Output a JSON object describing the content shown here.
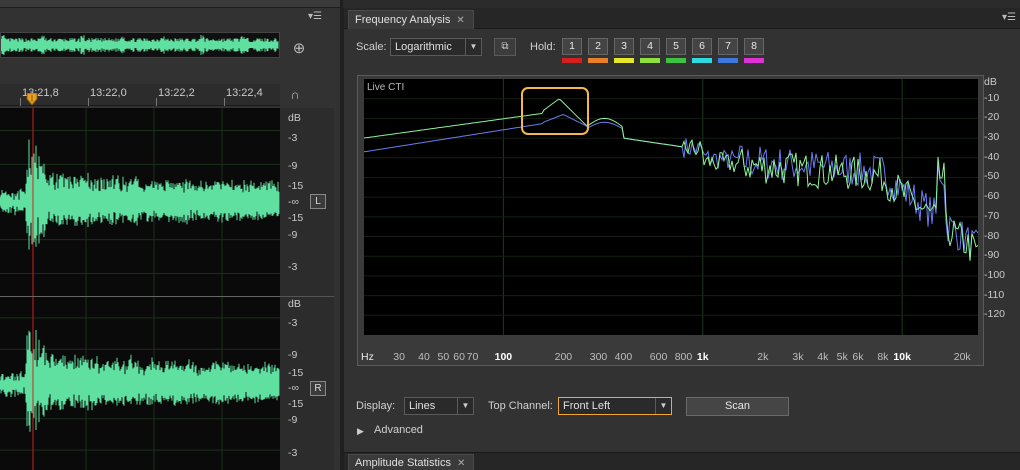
{
  "left_panel": {
    "ruler_labels": [
      "13:21,8",
      "13:22,0",
      "13:22,2",
      "13:22,4"
    ],
    "channel_l": {
      "db_labels": [
        "dB",
        "-3",
        "-9",
        "-15",
        "-∞",
        "-15",
        "-9",
        "-3"
      ],
      "badge": "L"
    },
    "channel_r": {
      "db_labels": [
        "dB",
        "-3",
        "-9",
        "-15",
        "-∞",
        "-15",
        "-9",
        "-3"
      ],
      "badge": "R"
    },
    "icons": {
      "zoom": "zoom-in-icon",
      "snap": "magnet-icon",
      "playhead": "playhead-marker-icon",
      "menu": "panel-menu-icon"
    },
    "waveform_color": "#5fe0a0"
  },
  "frequency_analysis": {
    "tab_label": "Frequency Analysis",
    "scale_label": "Scale:",
    "scale_value": "Logarithmic",
    "hold_label": "Hold:",
    "hold_buttons": [
      {
        "label": "1",
        "color": "#d42020"
      },
      {
        "label": "2",
        "color": "#e8802a"
      },
      {
        "label": "3",
        "color": "#e6e62a"
      },
      {
        "label": "4",
        "color": "#8ee03a"
      },
      {
        "label": "5",
        "color": "#3cc43c"
      },
      {
        "label": "6",
        "color": "#30d8e0"
      },
      {
        "label": "7",
        "color": "#3c7ae0"
      },
      {
        "label": "8",
        "color": "#e030d8"
      }
    ],
    "live_label": "Live CTI",
    "freq_axis": {
      "hz_label": "Hz",
      "labels": [
        "30",
        "40",
        "50",
        "60",
        "70",
        "100",
        "200",
        "300",
        "400",
        "600",
        "800",
        "1k",
        "2k",
        "3k",
        "4k",
        "5k",
        "6k",
        "8k",
        "10k",
        "20k"
      ]
    },
    "db_axis": [
      "dB",
      "-10",
      "-20",
      "-30",
      "-40",
      "-50",
      "-60",
      "-70",
      "-80",
      "-90",
      "-100",
      "-110",
      "-120"
    ],
    "display_label": "Display:",
    "display_value": "Lines",
    "top_channel_label": "Top Channel:",
    "top_channel_value": "Front Left",
    "scan_label": "Scan",
    "advanced_label": "Advanced",
    "series_colors": {
      "green": "#8ff29a",
      "blue": "#6a7cf2"
    },
    "highlight_color": "#f3b94a"
  },
  "amplitude_statistics": {
    "tab_label": "Amplitude Statistics"
  }
}
